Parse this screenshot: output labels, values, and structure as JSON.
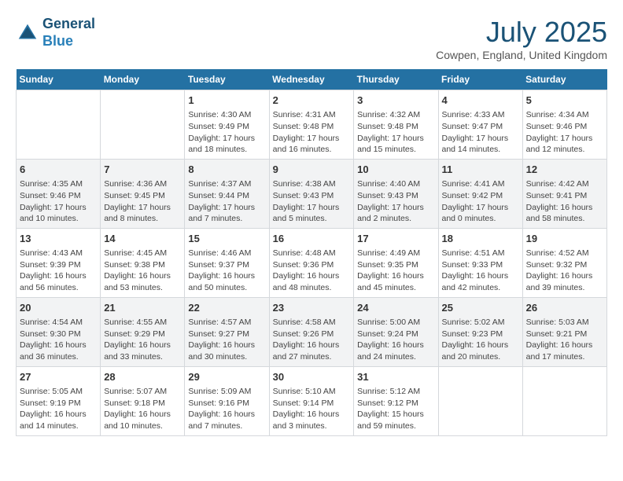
{
  "logo": {
    "line1": "General",
    "line2": "Blue"
  },
  "title": "July 2025",
  "location": "Cowpen, England, United Kingdom",
  "days_of_week": [
    "Sunday",
    "Monday",
    "Tuesday",
    "Wednesday",
    "Thursday",
    "Friday",
    "Saturday"
  ],
  "weeks": [
    [
      {
        "day": "",
        "content": ""
      },
      {
        "day": "",
        "content": ""
      },
      {
        "day": "1",
        "content": "Sunrise: 4:30 AM\nSunset: 9:49 PM\nDaylight: 17 hours and 18 minutes."
      },
      {
        "day": "2",
        "content": "Sunrise: 4:31 AM\nSunset: 9:48 PM\nDaylight: 17 hours and 16 minutes."
      },
      {
        "day": "3",
        "content": "Sunrise: 4:32 AM\nSunset: 9:48 PM\nDaylight: 17 hours and 15 minutes."
      },
      {
        "day": "4",
        "content": "Sunrise: 4:33 AM\nSunset: 9:47 PM\nDaylight: 17 hours and 14 minutes."
      },
      {
        "day": "5",
        "content": "Sunrise: 4:34 AM\nSunset: 9:46 PM\nDaylight: 17 hours and 12 minutes."
      }
    ],
    [
      {
        "day": "6",
        "content": "Sunrise: 4:35 AM\nSunset: 9:46 PM\nDaylight: 17 hours and 10 minutes."
      },
      {
        "day": "7",
        "content": "Sunrise: 4:36 AM\nSunset: 9:45 PM\nDaylight: 17 hours and 8 minutes."
      },
      {
        "day": "8",
        "content": "Sunrise: 4:37 AM\nSunset: 9:44 PM\nDaylight: 17 hours and 7 minutes."
      },
      {
        "day": "9",
        "content": "Sunrise: 4:38 AM\nSunset: 9:43 PM\nDaylight: 17 hours and 5 minutes."
      },
      {
        "day": "10",
        "content": "Sunrise: 4:40 AM\nSunset: 9:43 PM\nDaylight: 17 hours and 2 minutes."
      },
      {
        "day": "11",
        "content": "Sunrise: 4:41 AM\nSunset: 9:42 PM\nDaylight: 17 hours and 0 minutes."
      },
      {
        "day": "12",
        "content": "Sunrise: 4:42 AM\nSunset: 9:41 PM\nDaylight: 16 hours and 58 minutes."
      }
    ],
    [
      {
        "day": "13",
        "content": "Sunrise: 4:43 AM\nSunset: 9:39 PM\nDaylight: 16 hours and 56 minutes."
      },
      {
        "day": "14",
        "content": "Sunrise: 4:45 AM\nSunset: 9:38 PM\nDaylight: 16 hours and 53 minutes."
      },
      {
        "day": "15",
        "content": "Sunrise: 4:46 AM\nSunset: 9:37 PM\nDaylight: 16 hours and 50 minutes."
      },
      {
        "day": "16",
        "content": "Sunrise: 4:48 AM\nSunset: 9:36 PM\nDaylight: 16 hours and 48 minutes."
      },
      {
        "day": "17",
        "content": "Sunrise: 4:49 AM\nSunset: 9:35 PM\nDaylight: 16 hours and 45 minutes."
      },
      {
        "day": "18",
        "content": "Sunrise: 4:51 AM\nSunset: 9:33 PM\nDaylight: 16 hours and 42 minutes."
      },
      {
        "day": "19",
        "content": "Sunrise: 4:52 AM\nSunset: 9:32 PM\nDaylight: 16 hours and 39 minutes."
      }
    ],
    [
      {
        "day": "20",
        "content": "Sunrise: 4:54 AM\nSunset: 9:30 PM\nDaylight: 16 hours and 36 minutes."
      },
      {
        "day": "21",
        "content": "Sunrise: 4:55 AM\nSunset: 9:29 PM\nDaylight: 16 hours and 33 minutes."
      },
      {
        "day": "22",
        "content": "Sunrise: 4:57 AM\nSunset: 9:27 PM\nDaylight: 16 hours and 30 minutes."
      },
      {
        "day": "23",
        "content": "Sunrise: 4:58 AM\nSunset: 9:26 PM\nDaylight: 16 hours and 27 minutes."
      },
      {
        "day": "24",
        "content": "Sunrise: 5:00 AM\nSunset: 9:24 PM\nDaylight: 16 hours and 24 minutes."
      },
      {
        "day": "25",
        "content": "Sunrise: 5:02 AM\nSunset: 9:23 PM\nDaylight: 16 hours and 20 minutes."
      },
      {
        "day": "26",
        "content": "Sunrise: 5:03 AM\nSunset: 9:21 PM\nDaylight: 16 hours and 17 minutes."
      }
    ],
    [
      {
        "day": "27",
        "content": "Sunrise: 5:05 AM\nSunset: 9:19 PM\nDaylight: 16 hours and 14 minutes."
      },
      {
        "day": "28",
        "content": "Sunrise: 5:07 AM\nSunset: 9:18 PM\nDaylight: 16 hours and 10 minutes."
      },
      {
        "day": "29",
        "content": "Sunrise: 5:09 AM\nSunset: 9:16 PM\nDaylight: 16 hours and 7 minutes."
      },
      {
        "day": "30",
        "content": "Sunrise: 5:10 AM\nSunset: 9:14 PM\nDaylight: 16 hours and 3 minutes."
      },
      {
        "day": "31",
        "content": "Sunrise: 5:12 AM\nSunset: 9:12 PM\nDaylight: 15 hours and 59 minutes."
      },
      {
        "day": "",
        "content": ""
      },
      {
        "day": "",
        "content": ""
      }
    ]
  ]
}
